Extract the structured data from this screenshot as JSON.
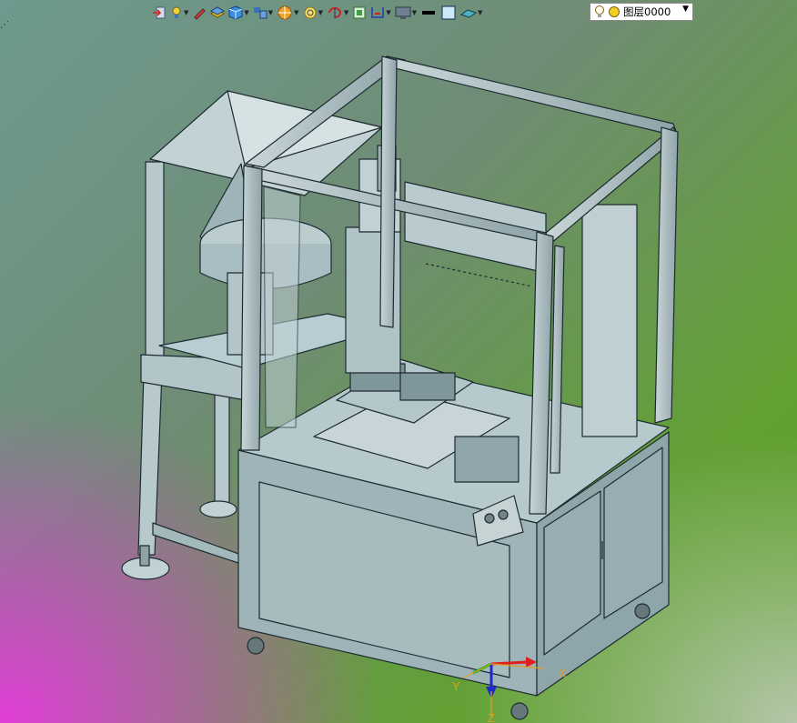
{
  "toolbar": {
    "icons": [
      "exit-icon",
      "light-icon",
      "pen-icon",
      "stack-icon",
      "cube-icon",
      "multi-view-icon",
      "render-icon",
      "zoom-icon",
      "rotate-icon",
      "fit-icon",
      "section-icon",
      "monitor-icon",
      "line-color-icon",
      "fill-color-icon",
      "surface-icon"
    ]
  },
  "layer": {
    "name": "图层0000"
  },
  "axes": {
    "x": "X",
    "y": "Y",
    "z": "Z"
  },
  "colors": {
    "machine_fill": "#a9c0c3",
    "machine_edge": "#1d2b30"
  }
}
